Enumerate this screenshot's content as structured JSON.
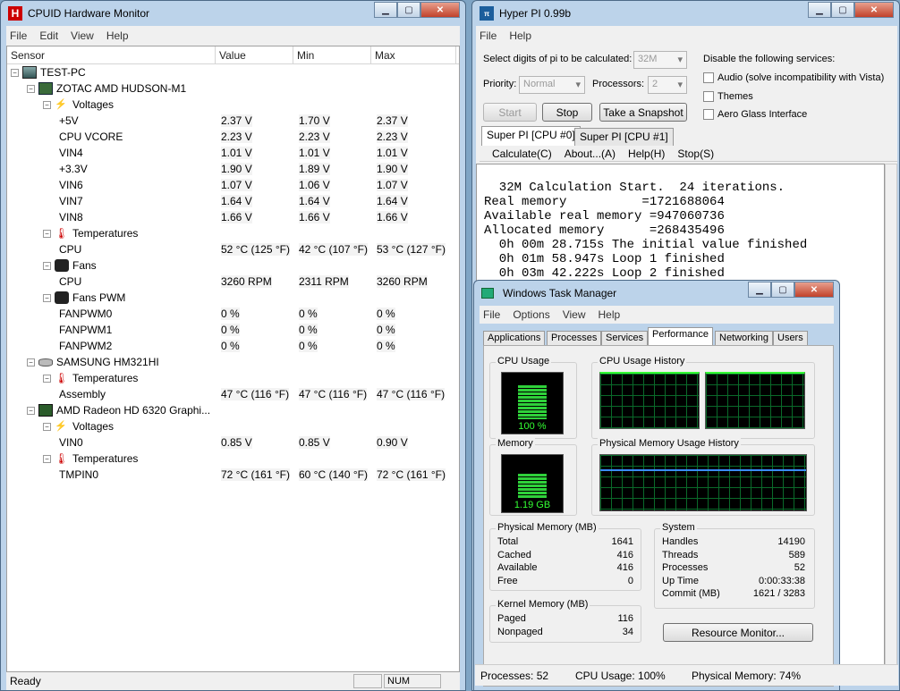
{
  "hw": {
    "title": "CPUID Hardware Monitor",
    "menu": [
      "File",
      "Edit",
      "View",
      "Help"
    ],
    "columns": [
      "Sensor",
      "Value",
      "Min",
      "Max"
    ],
    "rows": [
      {
        "level": 0,
        "kind": "pc",
        "name": "TEST-PC"
      },
      {
        "level": 1,
        "kind": "mb",
        "name": "ZOTAC AMD HUDSON-M1"
      },
      {
        "level": 2,
        "kind": "volt",
        "name": "Voltages"
      },
      {
        "level": 3,
        "name": "+5V",
        "value": "2.37 V",
        "min": "1.70 V",
        "max": "2.37 V"
      },
      {
        "level": 3,
        "name": "CPU VCORE",
        "value": "2.23 V",
        "min": "2.23 V",
        "max": "2.23 V"
      },
      {
        "level": 3,
        "name": "VIN4",
        "value": "1.01 V",
        "min": "1.01 V",
        "max": "1.01 V"
      },
      {
        "level": 3,
        "name": "+3.3V",
        "value": "1.90 V",
        "min": "1.89 V",
        "max": "1.90 V"
      },
      {
        "level": 3,
        "name": "VIN6",
        "value": "1.07 V",
        "min": "1.06 V",
        "max": "1.07 V"
      },
      {
        "level": 3,
        "name": "VIN7",
        "value": "1.64 V",
        "min": "1.64 V",
        "max": "1.64 V"
      },
      {
        "level": 3,
        "name": "VIN8",
        "value": "1.66 V",
        "min": "1.66 V",
        "max": "1.66 V"
      },
      {
        "level": 2,
        "kind": "temp",
        "name": "Temperatures"
      },
      {
        "level": 3,
        "name": "CPU",
        "value": "52 °C  (125 °F)",
        "min": "42 °C  (107 °F)",
        "max": "53 °C  (127 °F)"
      },
      {
        "level": 2,
        "kind": "fan",
        "name": "Fans"
      },
      {
        "level": 3,
        "name": "CPU",
        "value": "3260 RPM",
        "min": "2311 RPM",
        "max": "3260 RPM"
      },
      {
        "level": 2,
        "kind": "fan",
        "name": "Fans PWM"
      },
      {
        "level": 3,
        "name": "FANPWM0",
        "value": "0 %",
        "min": "0 %",
        "max": "0 %"
      },
      {
        "level": 3,
        "name": "FANPWM1",
        "value": "0 %",
        "min": "0 %",
        "max": "0 %"
      },
      {
        "level": 3,
        "name": "FANPWM2",
        "value": "0 %",
        "min": "0 %",
        "max": "0 %"
      },
      {
        "level": 1,
        "kind": "hdd",
        "name": "SAMSUNG HM321HI"
      },
      {
        "level": 2,
        "kind": "temp",
        "name": "Temperatures"
      },
      {
        "level": 3,
        "name": "Assembly",
        "value": "47 °C  (116 °F)",
        "min": "47 °C  (116 °F)",
        "max": "47 °C  (116 °F)"
      },
      {
        "level": 1,
        "kind": "gpu",
        "name": "AMD Radeon HD 6320 Graphi..."
      },
      {
        "level": 2,
        "kind": "volt",
        "name": "Voltages"
      },
      {
        "level": 3,
        "name": "VIN0",
        "value": "0.85 V",
        "min": "0.85 V",
        "max": "0.90 V"
      },
      {
        "level": 2,
        "kind": "temp",
        "name": "Temperatures"
      },
      {
        "level": 3,
        "name": "TMPIN0",
        "value": "72 °C  (161 °F)",
        "min": "60 °C  (140 °F)",
        "max": "72 °C  (161 °F)"
      }
    ],
    "status": "Ready",
    "num": "NUM"
  },
  "hp": {
    "title": "Hyper PI 0.99b",
    "menu": [
      "File",
      "Help"
    ],
    "digits_label": "Select digits of pi to be calculated:",
    "digits_value": "32M",
    "priority_label": "Priority:",
    "priority_value": "Normal",
    "processors_label": "Processors:",
    "processors_value": "2",
    "disable_label": "Disable the following services:",
    "services": [
      "Audio (solve incompatibility with Vista)",
      "Themes",
      "Aero Glass Interface"
    ],
    "start": "Start",
    "stop": "Stop",
    "snapshot": "Take a Snapshot",
    "tabs": [
      "Super PI [CPU #0]",
      "Super PI [CPU #1]"
    ],
    "submenu": [
      "Calculate(C)",
      "About...(A)",
      "Help(H)",
      "Stop(S)"
    ],
    "console": [
      "  32M Calculation Start.  24 iterations.",
      "Real memory          =1721688064",
      "Available real memory =947060736",
      "Allocated memory      =268435496",
      "  0h 00m 28.715s The initial value finished",
      "  0h 01m 58.947s Loop 1 finished",
      "  0h 03m 42.222s Loop 2 finished"
    ]
  },
  "tm": {
    "title": "Windows Task Manager",
    "menu": [
      "File",
      "Options",
      "View",
      "Help"
    ],
    "tabs": [
      "Applications",
      "Processes",
      "Services",
      "Performance",
      "Networking",
      "Users"
    ],
    "cpu_usage_label": "CPU Usage",
    "cpu_usage_value": "100 %",
    "cpu_history_label": "CPU Usage History",
    "memory_label": "Memory",
    "memory_value": "1.19 GB",
    "mem_history_label": "Physical Memory Usage History",
    "physical_label": "Physical Memory (MB)",
    "physical": [
      [
        "Total",
        "1641"
      ],
      [
        "Cached",
        "416"
      ],
      [
        "Available",
        "416"
      ],
      [
        "Free",
        "0"
      ]
    ],
    "kernel_label": "Kernel Memory (MB)",
    "kernel": [
      [
        "Paged",
        "116"
      ],
      [
        "Nonpaged",
        "34"
      ]
    ],
    "system_label": "System",
    "system": [
      [
        "Handles",
        "14190"
      ],
      [
        "Threads",
        "589"
      ],
      [
        "Processes",
        "52"
      ],
      [
        "Up Time",
        "0:00:33:38"
      ],
      [
        "Commit (MB)",
        "1621 / 3283"
      ]
    ],
    "resource_button": "Resource Monitor...",
    "status_processes": "Processes: 52",
    "status_cpu": "CPU Usage: 100%",
    "status_mem": "Physical Memory: 74%",
    "cpu_fraction": 1.0,
    "mem_fraction": 0.74
  }
}
